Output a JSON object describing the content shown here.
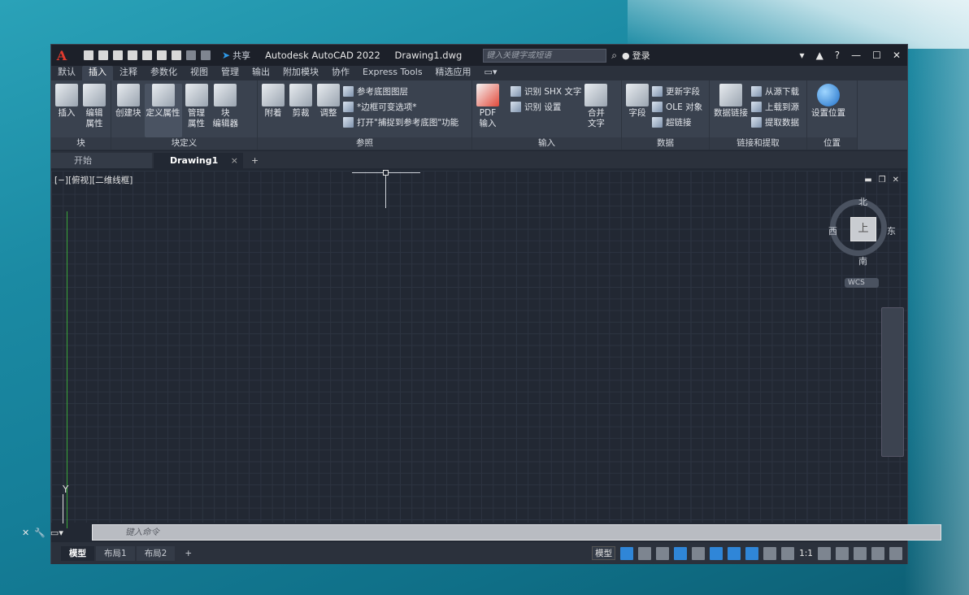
{
  "titlebar": {
    "logo": "A",
    "share_label": "共享",
    "app_title": "Autodesk AutoCAD 2022",
    "file_name": "Drawing1.dwg",
    "search_placeholder": "键入关键字或短语",
    "login_label": "登录"
  },
  "menu": {
    "tabs": [
      "默认",
      "插入",
      "注释",
      "参数化",
      "视图",
      "管理",
      "输出",
      "附加模块",
      "协作",
      "Express Tools",
      "精选应用"
    ],
    "active": "插入"
  },
  "ribbon": {
    "block_panel": {
      "title": "块",
      "insert": "插入",
      "edit_attr_1": "编辑",
      "edit_attr_2": "属性"
    },
    "blockdef_panel": {
      "title": "块定义",
      "create": "创建块",
      "define": "定义属性",
      "manage_1": "管理",
      "manage_2": "属性",
      "editor_1": "块",
      "editor_2": "编辑器"
    },
    "ref_panel": {
      "title": "参照",
      "attach": "附着",
      "clip": "剪裁",
      "adjust": "调整",
      "underlay_layers": "参考底图图层",
      "frame_variable": "*边框可变选项*",
      "snap_underlay": "打开\"捕捉到参考底图\"功能"
    },
    "import_panel": {
      "title": "输入",
      "pdf_1": "PDF",
      "pdf_2": "输入",
      "recognize_shx": "识别 SHX 文字",
      "recognize_settings": "识别 设置",
      "combine_1": "合并",
      "combine_2": "文字"
    },
    "data_panel": {
      "title": "数据",
      "field": "字段",
      "update_field": "更新字段",
      "ole": "OLE 对象",
      "hyperlink": "超链接"
    },
    "link_panel": {
      "title": "链接和提取",
      "data_link": "数据链接",
      "download": "从源下载",
      "upload": "上载到源",
      "extract": "提取数据"
    },
    "location_panel": {
      "title": "位置",
      "set_location": "设置位置"
    }
  },
  "doctabs": {
    "start": "开始",
    "drawing": "Drawing1",
    "close": "×",
    "plus": "+"
  },
  "viewport": {
    "label": "[−][俯视][二维线框]",
    "viewcube": {
      "north": "北",
      "south": "南",
      "east": "东",
      "west": "西",
      "top": "上"
    },
    "wcs": "WCS",
    "ucs_y": "Y"
  },
  "command_line": {
    "placeholder": "键入命令"
  },
  "layout_tabs": {
    "model": "模型",
    "layout1": "布局1",
    "layout2": "布局2",
    "plus": "+"
  },
  "status": {
    "model": "模型",
    "scale": "1:1"
  }
}
